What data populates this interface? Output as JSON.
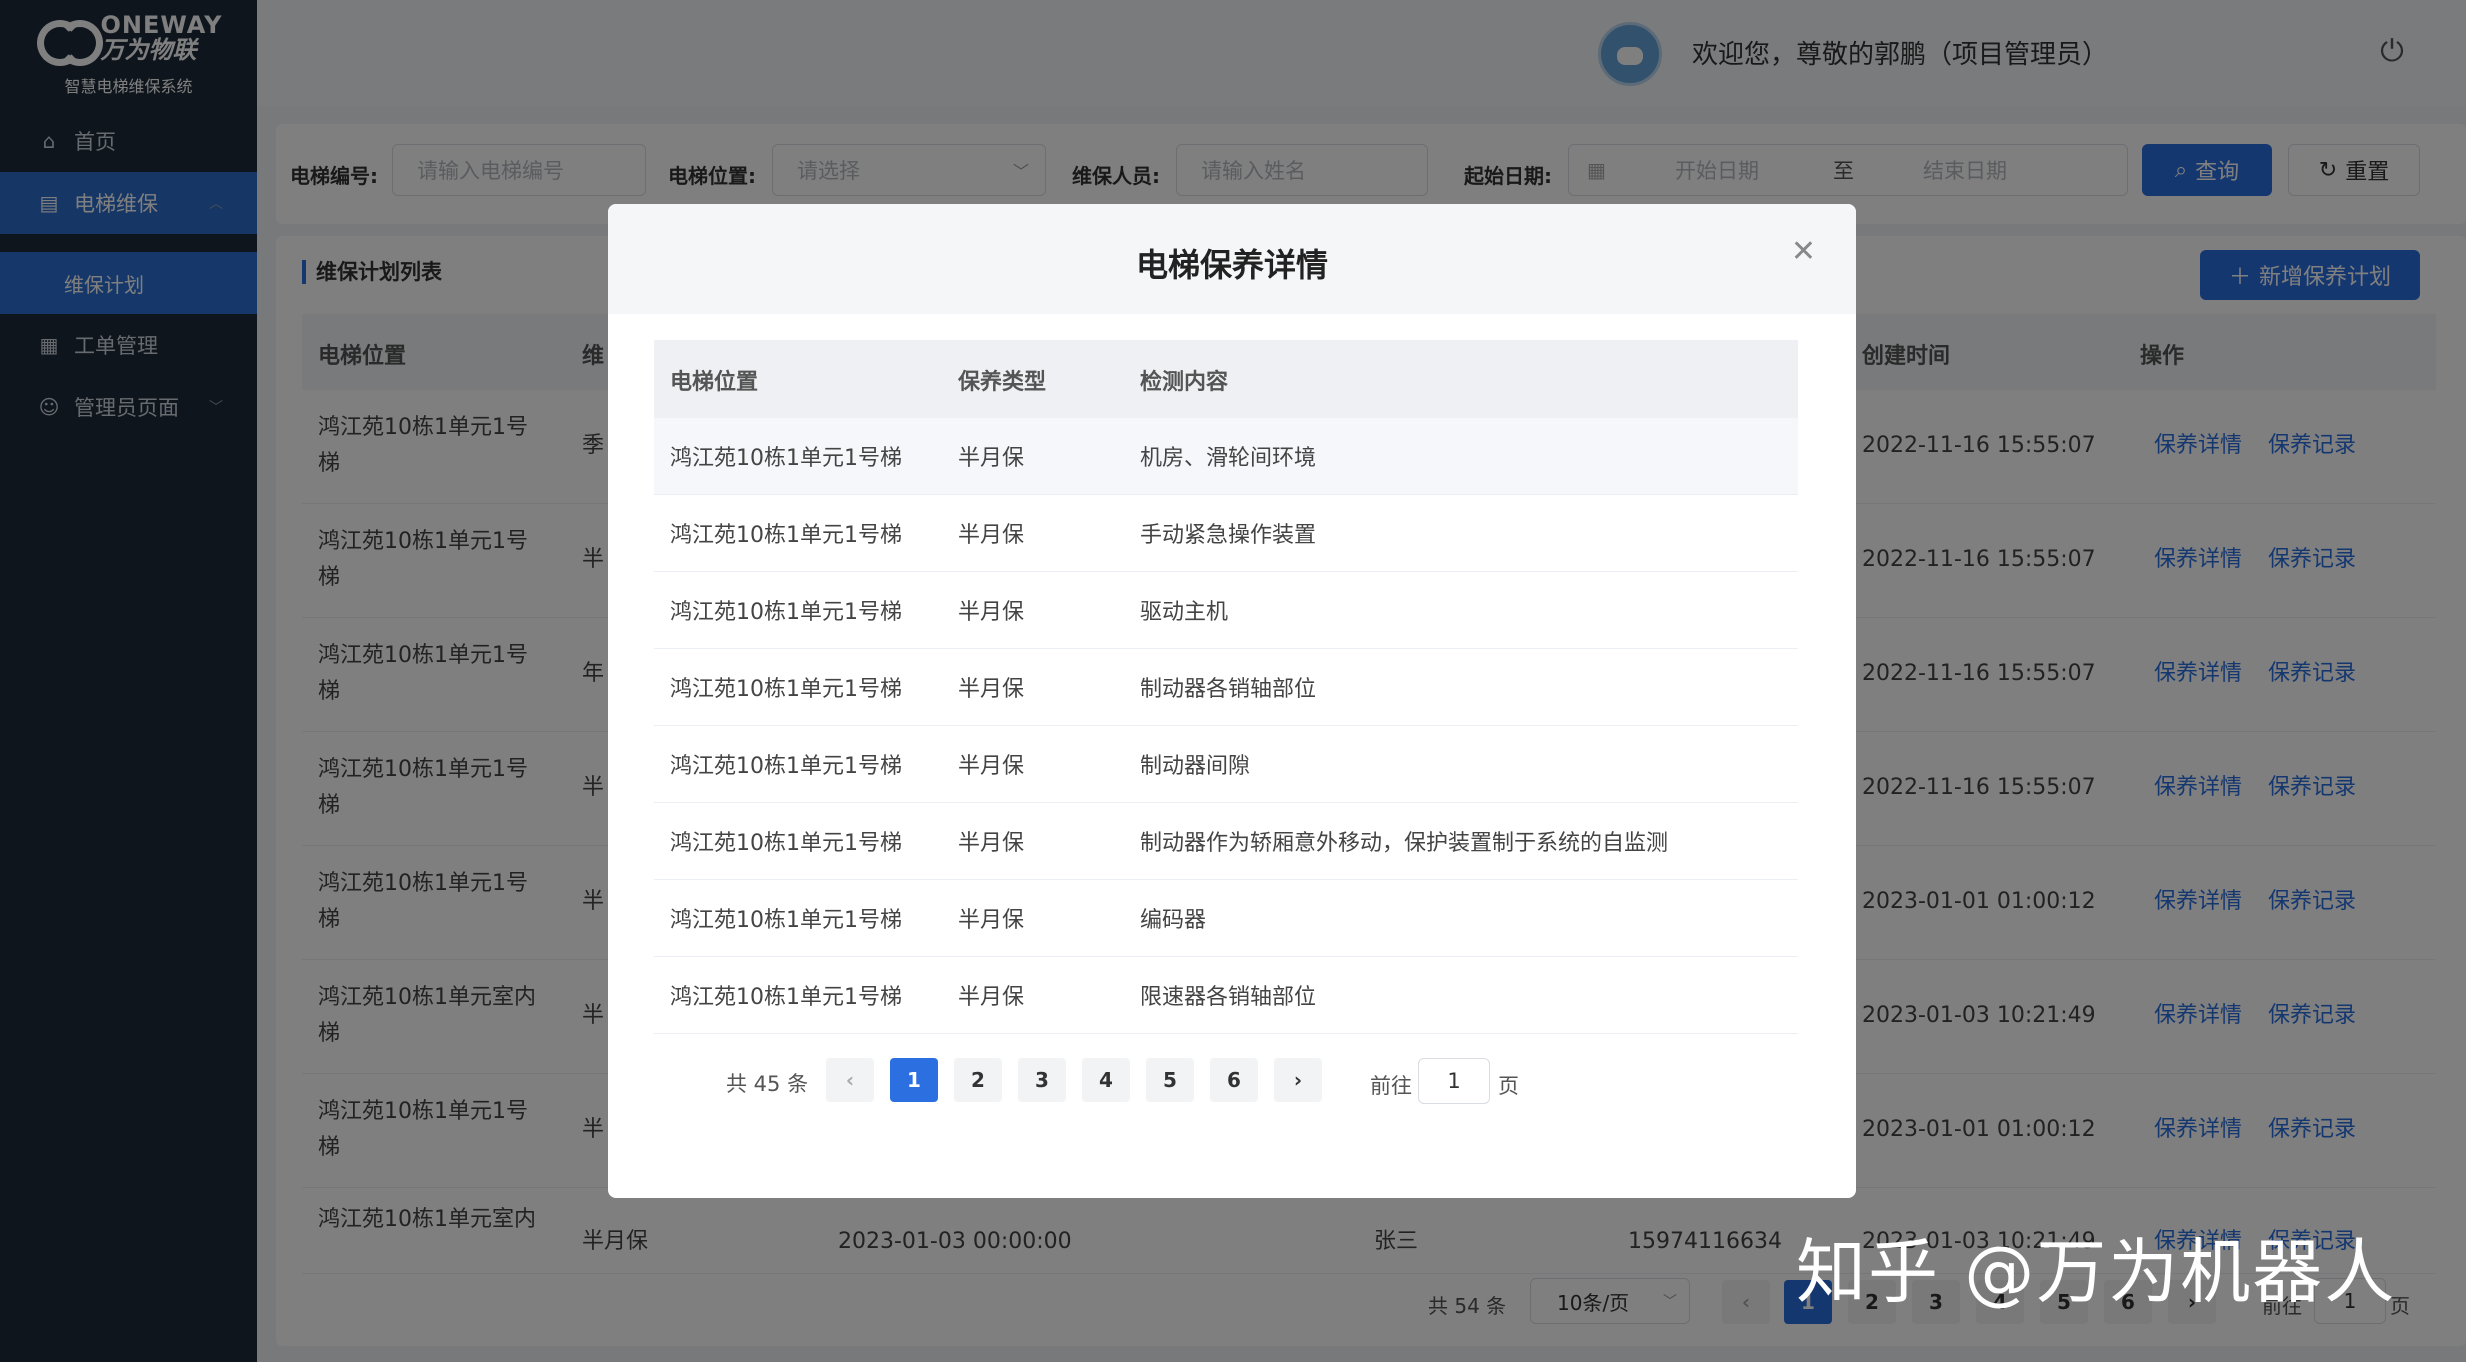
{
  "brand": {
    "name_en": "ONEWAY",
    "name_cn": "万为物联",
    "subtitle": "智慧电梯维保系统"
  },
  "sidebar": {
    "items": [
      {
        "label": "首页",
        "icon": "home-icon"
      },
      {
        "label": "电梯维保",
        "icon": "document-icon"
      },
      {
        "label": "维保计划"
      },
      {
        "label": "工单管理",
        "icon": "clipboard-icon"
      },
      {
        "label": "管理员页面",
        "icon": "user-gear-icon"
      }
    ]
  },
  "header": {
    "welcome": "欢迎您，尊敬的郭鹏（项目管理员）"
  },
  "filter": {
    "elevator_no_label": "电梯编号:",
    "elevator_no_placeholder": "请输入电梯编号",
    "location_label": "电梯位置:",
    "location_placeholder": "请选择",
    "staff_label": "维保人员:",
    "staff_placeholder": "请输入姓名",
    "date_label": "起始日期:",
    "start_placeholder": "开始日期",
    "date_sep": "至",
    "end_placeholder": "结束日期",
    "query_label": "查询",
    "reset_label": "重置"
  },
  "list": {
    "title": "维保计划列表",
    "add_label": "新增保养计划",
    "columns": {
      "location": "电梯位置",
      "type_partial": "维",
      "created": "创建时间",
      "actions": "操作"
    },
    "rows": [
      {
        "location_l1": "鸿江苑10栋1单元1号",
        "location_l2": "梯",
        "type": "季",
        "created": "2022-11-16 15:55:07"
      },
      {
        "location_l1": "鸿江苑10栋1单元1号",
        "location_l2": "梯",
        "type": "半",
        "created": "2022-11-16 15:55:07"
      },
      {
        "location_l1": "鸿江苑10栋1单元1号",
        "location_l2": "梯",
        "type": "年",
        "created": "2022-11-16 15:55:07"
      },
      {
        "location_l1": "鸿江苑10栋1单元1号",
        "location_l2": "梯",
        "type": "半",
        "created": "2022-11-16 15:55:07"
      },
      {
        "location_l1": "鸿江苑10栋1单元1号",
        "location_l2": "梯",
        "type": "半",
        "created": "2023-01-01 01:00:12"
      },
      {
        "location_l1": "鸿江苑10栋1单元室内",
        "location_l2": "梯",
        "type": "半",
        "created": "2023-01-03 10:21:49"
      },
      {
        "location_l1": "鸿江苑10栋1单元1号",
        "location_l2": "梯",
        "type": "半",
        "created": "2023-01-01 01:00:12"
      }
    ],
    "last_row": {
      "location": "鸿江苑10栋1单元室内",
      "type": "半月保",
      "start": "2023-01-03 00:00:00",
      "staff": "张三",
      "phone": "15974116634",
      "created": "2023-01-03 10:21:49"
    },
    "detail_link": "保养详情",
    "record_link": "保养记录",
    "pager": {
      "total": "共 54 条",
      "size": "10条/页",
      "pages": [
        "1",
        "2",
        "3",
        "4",
        "5",
        "6"
      ],
      "goto": "前往",
      "goto_value": "1",
      "unit": "页"
    }
  },
  "modal": {
    "title": "电梯保养详情",
    "columns": {
      "location": "电梯位置",
      "type": "保养类型",
      "content": "检测内容"
    },
    "rows": [
      {
        "location": "鸿江苑10栋1单元1号梯",
        "type": "半月保",
        "content": "机房、滑轮间环境"
      },
      {
        "location": "鸿江苑10栋1单元1号梯",
        "type": "半月保",
        "content": "手动紧急操作装置"
      },
      {
        "location": "鸿江苑10栋1单元1号梯",
        "type": "半月保",
        "content": "驱动主机"
      },
      {
        "location": "鸿江苑10栋1单元1号梯",
        "type": "半月保",
        "content": "制动器各销轴部位"
      },
      {
        "location": "鸿江苑10栋1单元1号梯",
        "type": "半月保",
        "content": "制动器间隙"
      },
      {
        "location": "鸿江苑10栋1单元1号梯",
        "type": "半月保",
        "content": "制动器作为轿厢意外移动，保护装置制于系统的自监测"
      },
      {
        "location": "鸿江苑10栋1单元1号梯",
        "type": "半月保",
        "content": "编码器"
      },
      {
        "location": "鸿江苑10栋1单元1号梯",
        "type": "半月保",
        "content": "限速器各销轴部位"
      }
    ],
    "pager": {
      "total": "共 45 条",
      "pages": [
        "1",
        "2",
        "3",
        "4",
        "5",
        "6"
      ],
      "goto": "前往",
      "goto_value": "1",
      "unit": "页"
    }
  },
  "watermark": "知乎 @万为机器人",
  "colors": {
    "primary": "#2b6fe0",
    "sidebar": "#1e2a3a"
  }
}
